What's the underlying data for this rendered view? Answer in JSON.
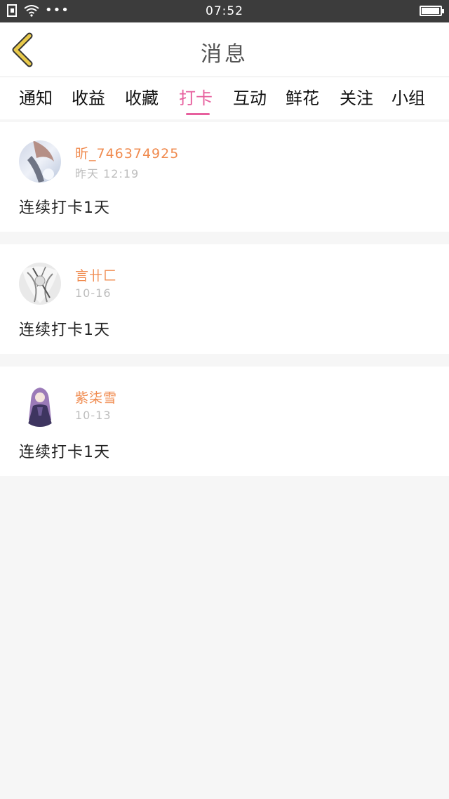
{
  "status_bar": {
    "time": "07:52",
    "battery_level": 0.95
  },
  "header": {
    "back_icon": "chevron-left-icon",
    "title": "消息"
  },
  "tabs": [
    {
      "label": "通知",
      "active": false
    },
    {
      "label": "收益",
      "active": false
    },
    {
      "label": "收藏",
      "active": false
    },
    {
      "label": "打卡",
      "active": true
    },
    {
      "label": "互动",
      "active": false
    },
    {
      "label": "鲜花",
      "active": false
    },
    {
      "label": "关注",
      "active": false
    },
    {
      "label": "小组",
      "active": false
    }
  ],
  "messages": [
    {
      "username": "昕_746374925",
      "time": "昨天 12:19",
      "text": "连续打卡1天"
    },
    {
      "username": "言卄匚",
      "time": "10-16",
      "text": "连续打卡1天"
    },
    {
      "username": "紫柒雪",
      "time": "10-13",
      "text": "连续打卡1天"
    }
  ],
  "colors": {
    "accent": "#e7609e",
    "username": "#f08b4f",
    "back_icon": "#e8c94a",
    "timestamp": "#bdbdbd",
    "background": "#f6f6f6"
  }
}
